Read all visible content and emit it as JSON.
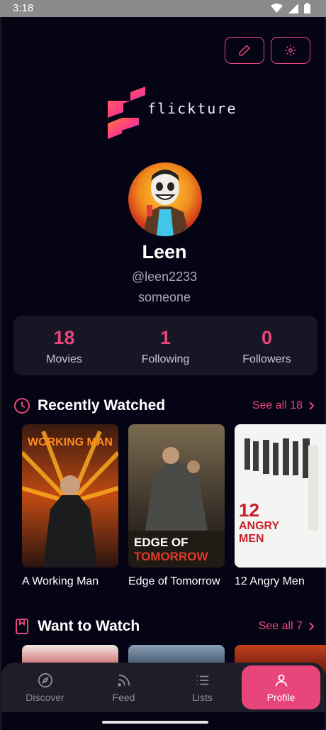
{
  "status_bar": {
    "time": "3:18"
  },
  "header": {
    "edit_icon": "pencil-icon",
    "settings_icon": "gear-icon"
  },
  "app": {
    "name": "flickture",
    "accent": "#e8467a"
  },
  "profile": {
    "name": "Leen",
    "handle": "@leen2233",
    "bio": "someone"
  },
  "stats": [
    {
      "value": "18",
      "label": "Movies"
    },
    {
      "value": "1",
      "label": "Following"
    },
    {
      "value": "0",
      "label": "Followers"
    }
  ],
  "recently_watched": {
    "title": "Recently Watched",
    "see_all": "See all 18",
    "items": [
      {
        "title": "A Working Man",
        "poster_text": "WORKING MAN"
      },
      {
        "title": "Edge of Tomorrow",
        "poster_text": "EDGE OF TOMORROW"
      },
      {
        "title": "12 Angry Men",
        "poster_text": "12 ANGRY MEN"
      }
    ]
  },
  "want_to_watch": {
    "title": "Want to Watch",
    "see_all": "See all 7"
  },
  "tabs": [
    {
      "label": "Discover",
      "icon": "compass-icon",
      "active": false
    },
    {
      "label": "Feed",
      "icon": "rss-icon",
      "active": false
    },
    {
      "label": "Lists",
      "icon": "list-icon",
      "active": false
    },
    {
      "label": "Profile",
      "icon": "user-icon",
      "active": true
    }
  ]
}
